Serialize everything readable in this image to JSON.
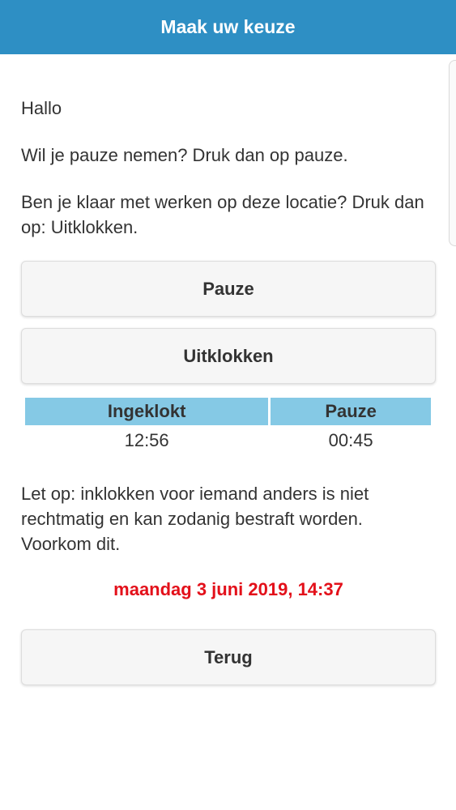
{
  "header": {
    "title": "Maak uw keuze"
  },
  "intro": {
    "greeting": "Hallo",
    "pause_text": "Wil je pauze nemen? Druk dan op pauze.",
    "clockout_text": "Ben je klaar met werken op deze locatie? Druk dan op: Uitklokken."
  },
  "buttons": {
    "pause_label": "Pauze",
    "clockout_label": "Uitklokken",
    "back_label": "Terug"
  },
  "status_table": {
    "headers": [
      "Ingeklokt",
      "Pauze"
    ],
    "values": [
      "12:56",
      "00:45"
    ]
  },
  "warning_text": "Let op: inklokken voor iemand anders is niet rechtmatig en kan zodanig bestraft worden. Voorkom dit.",
  "datetime": "maandag 3 juni 2019, 14:37",
  "colors": {
    "header_bg": "#2e8fc4",
    "table_header_bg": "#85c9e5",
    "datetime_text": "#e3101a"
  }
}
